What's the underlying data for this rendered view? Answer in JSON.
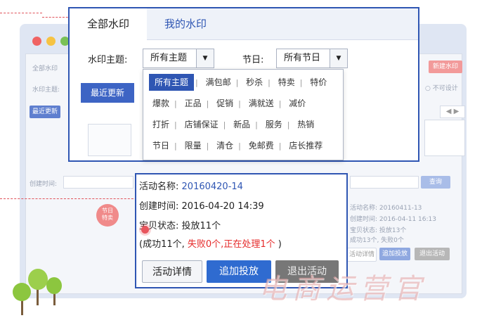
{
  "colors": {
    "accent": "#2f56b3",
    "danger": "#e52a2a",
    "primary_button": "#2f6bd0"
  },
  "background": {
    "labels": {
      "all_watermarks": "全部水印",
      "watermark_theme": "水印主题:",
      "recent": "最近更新",
      "new_watermark": "新建水印",
      "not_set": "不可设计",
      "created_time": "创建时间:",
      "query": "查询",
      "name_small": "活动名称: 20160411-13",
      "created_small": "创建时间: 2016-04-11 16:13",
      "status_small": "宝贝状态: 投放13个",
      "result_small": "成功13个, 失败0个",
      "detail_small": "活动详情",
      "add_small": "追加投放",
      "exit_small": "退出活动",
      "holiday_badge": "节日\n特卖"
    }
  },
  "panel1": {
    "tabs": [
      {
        "label": "全部水印"
      },
      {
        "label": "我的水印"
      }
    ],
    "theme_label": "水印主题:",
    "theme_value": "所有主题",
    "holiday_label": "节日:",
    "holiday_value": "所有节日",
    "recent_button": "最近更新",
    "dropdown_rows": [
      [
        "所有主题",
        "满包邮",
        "秒杀",
        "特卖",
        "特价"
      ],
      [
        "爆款",
        "正品",
        "促销",
        "满就送",
        "减价"
      ],
      [
        "打折",
        "店铺保证",
        "新品",
        "服务",
        "热销"
      ],
      [
        "节日",
        "限量",
        "清仓",
        "免邮费",
        "店长推荐"
      ]
    ]
  },
  "panel2": {
    "name_label": "活动名称:",
    "name_value": "20160420-14",
    "created_label": "创建时间:",
    "created_value": "2016-04-20 14:39",
    "status_label": "宝贝状态:",
    "status_value": "投放11个",
    "result_open": "(成功11个,",
    "result_failed": "失败0个",
    "result_sep": ",",
    "result_processing": "正在处理1个",
    "result_close": ")",
    "buttons": {
      "detail": "活动详情",
      "add": "追加投放",
      "exit": "退出活动"
    }
  },
  "watermark_text": "电商运营官"
}
